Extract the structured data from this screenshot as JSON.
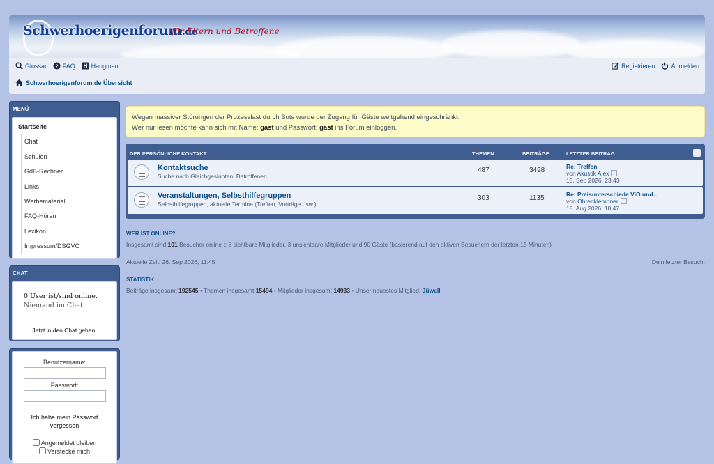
{
  "header": {
    "site_name": "Schwerhoerigenforum",
    "site_tld": ".de",
    "slogan": "für Eltern und Betroffene"
  },
  "navbar": {
    "left": [
      {
        "label": "Glossar",
        "icon": "search-icon"
      },
      {
        "label": "FAQ",
        "icon": "question-circle-icon"
      },
      {
        "label": "Hangman",
        "icon": "h-square-icon"
      }
    ],
    "right": [
      {
        "label": "Registrieren",
        "icon": "edit-icon"
      },
      {
        "label": "Anmelden",
        "icon": "power-icon"
      }
    ],
    "breadcrumb": "Schwerhoerigenforum.de Übersicht"
  },
  "sidebar": {
    "menu_title": "MENÜ",
    "menu_items": [
      "Startseite",
      "Chat",
      "Schulen",
      "GdB-Rechner",
      "Links",
      "Werbematerial",
      "FAQ-Hören",
      "Lexikon",
      "Impressum/DSGVO"
    ],
    "chat_title": "CHAT",
    "chat_users": "0 User ist/sind online.",
    "chat_nobody": "Niemand im Chat.",
    "chat_link": "Jetzt in den Chat gehen.",
    "login": {
      "username_label": "Benutzername:",
      "password_label": "Passwort:",
      "forgot_line1": "Ich habe mein Passwort",
      "forgot_line2": "vergessen",
      "remember": "Angemeldet bleiben",
      "hide": "Verstecke mich"
    }
  },
  "notice": {
    "line1": "Wegen massiver Störungen der Prozesslast durch Bots wurde der Zugang für Gäste weitgehend eingeschränkt.",
    "line2_pre": "Wer nur lesen möchte kann sich mit Name: ",
    "name": "gast",
    "line2_mid": " und Passwort: ",
    "password": "gast",
    "line2_post": " ins Forum einloggen."
  },
  "forum": {
    "category": "DER PERSÖNLICHE KONTAKT",
    "col_topics": "THEMEN",
    "col_posts": "BEITRÄGE",
    "col_last": "LETZTER BEITRAG",
    "rows": [
      {
        "title": "Kontaktsuche",
        "desc": "Suche nach Gleichgesinnten, Betroffenen",
        "topics": "487",
        "posts": "3498",
        "last_title": "Re: Treffen",
        "by": "von",
        "last_user": "Akustik Alex",
        "last_date": "15. Sep 2026, 23:43"
      },
      {
        "title": "Veranstaltungen, Selbsthilfegruppen",
        "desc": "Selbsthilfegruppen, aktuelle Termine (Treffen, Vorträge usw.)",
        "topics": "303",
        "posts": "1135",
        "last_title": "Re: Preisunterschiede ViO und…",
        "by": "von",
        "last_user": "Ohrenklempner",
        "last_date": "18. Aug 2026, 18:47"
      }
    ]
  },
  "online": {
    "title": "WER IST ONLINE?",
    "pre": "Insgesamt sind ",
    "count": "101",
    "post": " Besucher online :: 8 sichtbare Mitglieder, 3 unsichtbare Mitglieder und 90 Gäste (basierend auf den aktiven Besuchern der letzten 15 Minuten)"
  },
  "time": {
    "current": "Aktuelle Zeit: 26. Sep 2026, 11:45",
    "last_visit": "Dein letzter Besuch:"
  },
  "stats": {
    "title": "STATISTIK",
    "posts_label": "Beiträge insgesamt ",
    "posts": "192545",
    "topics_label": " • Themen insgesamt ",
    "topics": "15494",
    "members_label": " • Mitglieder insgesamt ",
    "members": "14933",
    "newest_label": " • Unser neuestes Mitglied: ",
    "newest": "Jüwall"
  }
}
